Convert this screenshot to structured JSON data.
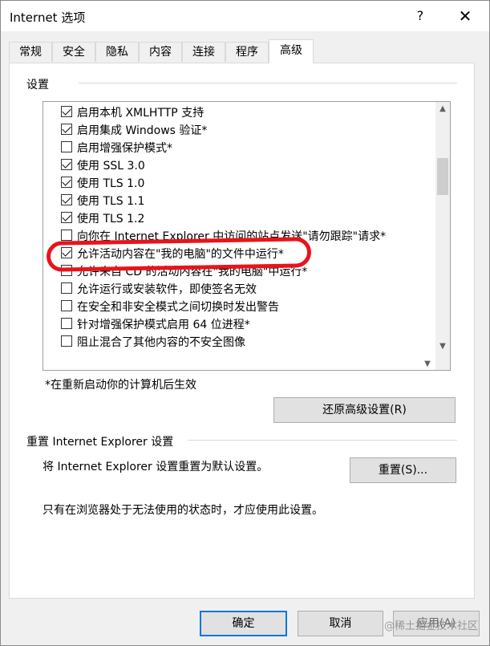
{
  "window": {
    "title": "Internet 选项",
    "help_glyph": "?",
    "close_glyph": "✕"
  },
  "tabs": [
    {
      "label": "常规"
    },
    {
      "label": "安全"
    },
    {
      "label": "隐私"
    },
    {
      "label": "内容"
    },
    {
      "label": "连接"
    },
    {
      "label": "程序"
    },
    {
      "label": "高级",
      "active": true
    }
  ],
  "settings": {
    "group_title": "设置",
    "items": [
      {
        "label": "启用本机 XMLHTTP 支持",
        "checked": true
      },
      {
        "label": "启用集成 Windows 验证*",
        "checked": true
      },
      {
        "label": "启用增强保护模式*",
        "checked": false
      },
      {
        "label": "使用 SSL 3.0",
        "checked": true
      },
      {
        "label": "使用 TLS 1.0",
        "checked": true
      },
      {
        "label": "使用 TLS 1.1",
        "checked": true
      },
      {
        "label": "使用 TLS 1.2",
        "checked": true
      },
      {
        "label": "向你在 Internet Explorer 中访问的站点发送\"请勿跟踪\"请求*",
        "checked": false
      },
      {
        "label": "允许活动内容在\"我的电脑\"的文件中运行*",
        "checked": true
      },
      {
        "label": "允许来自 CD 的活动内容在\"我的电脑\"中运行*",
        "checked": false
      },
      {
        "label": "允许运行或安装软件，即使签名无效",
        "checked": false
      },
      {
        "label": "在安全和非安全模式之间切换时发出警告",
        "checked": false
      },
      {
        "label": "针对增强保护模式启用 64 位进程*",
        "checked": false
      },
      {
        "label": "阻止混合了其他内容的不安全图像",
        "checked": false
      }
    ],
    "note": "*在重新启动你的计算机后生效",
    "restore_button": "还原高级设置(R)"
  },
  "reset": {
    "group_title": "重置 Internet Explorer 设置",
    "description": "将 Internet Explorer 设置重置为默认设置。",
    "reset_button": "重置(S)...",
    "warning": "只有在浏览器处于无法使用的状态时，才应使用此设置。"
  },
  "footer": {
    "ok_button": "确定",
    "cancel_button": "取消",
    "apply_button": "应用(A)"
  },
  "watermark": "@稀土掘金技术社区",
  "colors": {
    "annotation": "#e8141b",
    "focus_border": "#0078d7"
  }
}
